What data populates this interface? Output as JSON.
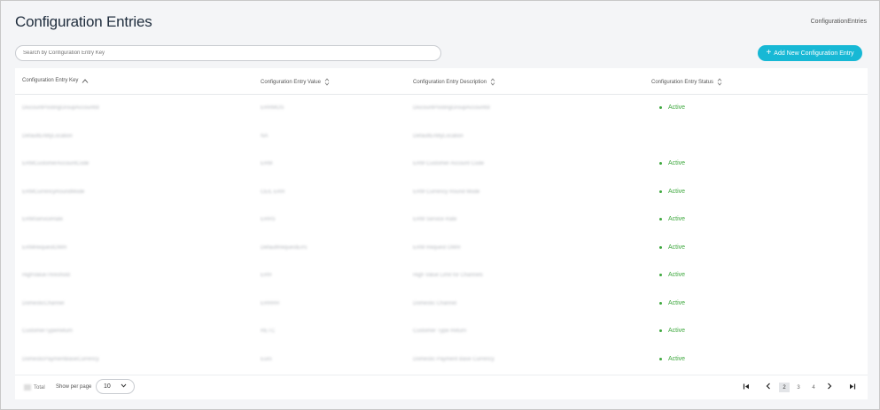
{
  "header": {
    "title": "Configuration Entries",
    "breadcrumb": "ConfigurationEntries"
  },
  "search": {
    "placeholder": "Search by Configuration Entry Key",
    "value": ""
  },
  "toolbar": {
    "add_label": "Add New Configuration Entry"
  },
  "table": {
    "columns": [
      "Configuration Entry Key",
      "Configuration Entry Value",
      "Configuration Entry Description",
      "Configuration Entry Status"
    ],
    "rows": [
      {
        "key": "DiscountPostingGroupAccountId",
        "value": "ERRMOS",
        "desc": "DiscountPostingGroupAccountId",
        "status": "Active"
      },
      {
        "key": "DefaultEntityLocation",
        "value": "NA",
        "desc": "DefaultEntityLocation",
        "status": ""
      },
      {
        "key": "ERMCustomerAccountCode",
        "value": "ERM",
        "desc": "ERM Customer Account Code",
        "status": "Active"
      },
      {
        "key": "ERMCurrencyRoundMode",
        "value": "CEIL ERR",
        "desc": "ERM Currency Round Mode",
        "status": "Active"
      },
      {
        "key": "ERMServiceRate",
        "value": "ERRS",
        "desc": "ERM Service Rate",
        "status": "Active"
      },
      {
        "key": "ERMRequestOWR",
        "value": "DefaultRequestErrs",
        "desc": "ERM Request OWR",
        "status": "Active"
      },
      {
        "key": "HighValueThreshold",
        "value": "ERR",
        "desc": "High Value Limit for Channels",
        "status": "Active"
      },
      {
        "key": "DomesticChannel",
        "value": "ERRRR",
        "desc": "Domestic Channel",
        "status": "Active"
      },
      {
        "key": "CustomerTypeReturn",
        "value": "RETC",
        "desc": "Customer Type Return",
        "status": "Active"
      },
      {
        "key": "DomesticPaymentBaseCurrency",
        "value": "Euro",
        "desc": "Domestic Payment Base Currency",
        "status": "Active"
      }
    ]
  },
  "footer": {
    "total_label": "Total",
    "per_page_label": "Show per page",
    "per_page_value": "10",
    "pages": [
      "2",
      "3",
      "4"
    ],
    "active_page": "2"
  },
  "colors": {
    "accent": "#17b8d5",
    "status_active": "#3ea83e"
  },
  "icons": [
    "plus-icon",
    "sort-asc-icon",
    "sort-both-icon",
    "chevron-down-icon",
    "first-page-icon",
    "prev-page-icon",
    "next-page-icon",
    "last-page-icon"
  ]
}
